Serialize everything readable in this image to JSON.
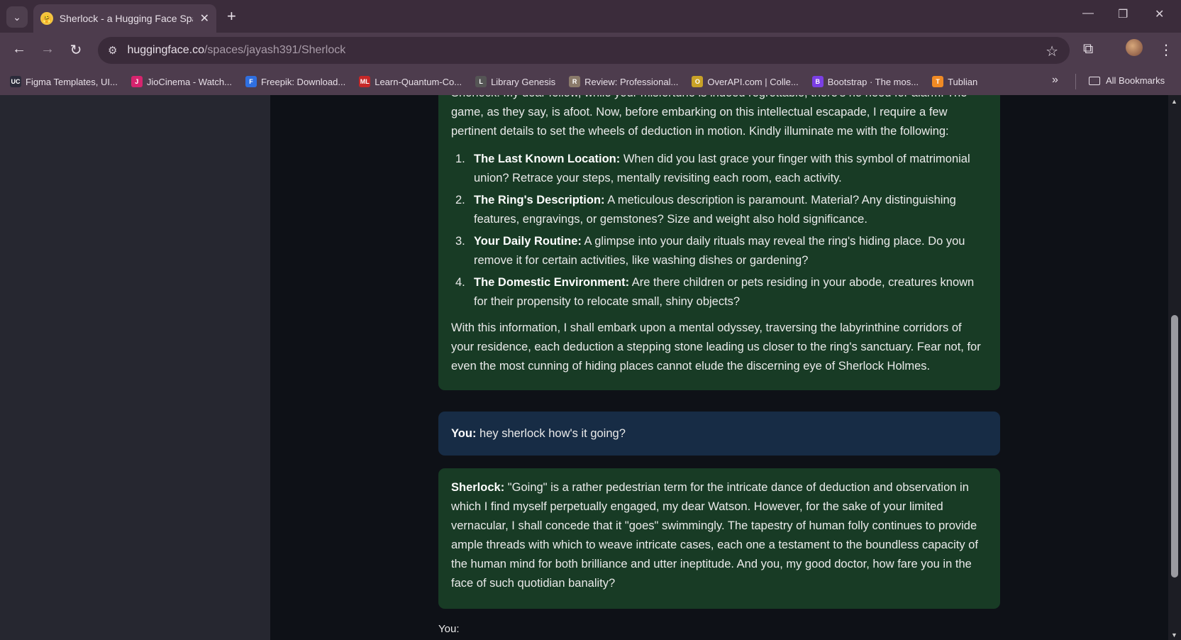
{
  "browser": {
    "tab_title": "Sherlock - a Hugging Face Space",
    "url_domain": "huggingface.co",
    "url_path": "/spaces/jayash391/Sherlock",
    "bookmarks": [
      {
        "label": "Figma Templates, UI...",
        "icon": "UC",
        "color": "#2b2b3a"
      },
      {
        "label": "JioCinema - Watch...",
        "icon": "J",
        "color": "#d6246e"
      },
      {
        "label": "Freepik: Download...",
        "icon": "F",
        "color": "#2f6fe0"
      },
      {
        "label": "Learn-Quantum-Co...",
        "icon": "ML",
        "color": "#c62828"
      },
      {
        "label": "Library Genesis",
        "icon": "L",
        "color": "#555555"
      },
      {
        "label": "Review: Professional...",
        "icon": "R",
        "color": "#8a7a6a"
      },
      {
        "label": "OverAPI.com | Colle...",
        "icon": "O",
        "color": "#c9a227"
      },
      {
        "label": "Bootstrap · The mos...",
        "icon": "B",
        "color": "#7b3fe4"
      },
      {
        "label": "Tublian",
        "icon": "T",
        "color": "#f08a24"
      }
    ],
    "all_bookmarks": "All Bookmarks"
  },
  "chat": {
    "msg1": {
      "cut_line": "Sherlock: My dear fellow, while your misfortune is indeed regrettable, there's no need for alarm. The",
      "intro": "game, as they say, is afoot. Now, before embarking on this intellectual escapade, I require a few pertinent details to set the wheels of deduction in motion. Kindly illuminate me with the following:",
      "items": [
        {
          "num": "1.",
          "title": "The Last Known Location:",
          "text": " When did you last grace your finger with this symbol of matrimonial union? Retrace your steps, mentally revisiting each room, each activity."
        },
        {
          "num": "2.",
          "title": "The Ring's Description:",
          "text": " A meticulous description is paramount. Material? Any distinguishing features, engravings, or gemstones? Size and weight also hold significance."
        },
        {
          "num": "3.",
          "title": "Your Daily Routine:",
          "text": " A glimpse into your daily rituals may reveal the ring's hiding place. Do you remove it for certain activities, like washing dishes or gardening?"
        },
        {
          "num": "4.",
          "title": "The Domestic Environment:",
          "text": " Are there children or pets residing in your abode, creatures known for their propensity to relocate small, shiny objects?"
        }
      ],
      "closing": "With this information, I shall embark upon a mental odyssey, traversing the labyrinthine corridors of your residence, each deduction a stepping stone leading us closer to the ring's sanctuary. Fear not, for even the most cunning of hiding places cannot elude the discerning eye of Sherlock Holmes."
    },
    "msg2": {
      "speaker": "You:",
      "text": " hey sherlock how's it going?"
    },
    "msg3": {
      "speaker": "Sherlock:",
      "text": " \"Going\" is a rather pedestrian term for the intricate dance of deduction and observation in which I find myself perpetually engaged, my dear Watson. However, for the sake of your limited vernacular, I shall concede that it \"goes\" swimmingly. The tapestry of human folly continues to provide ample threads with which to weave intricate cases, each one a testament to the boundless capacity of the human mind for both brilliance and utter ineptitude. And you, my good doctor, how fare you in the face of such quotidian banality?"
    },
    "input_label": "You:"
  }
}
